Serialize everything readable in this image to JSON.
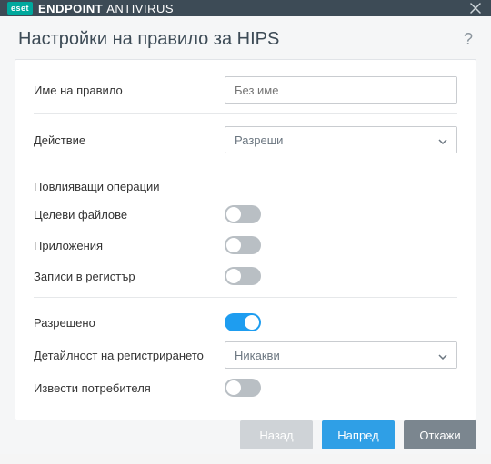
{
  "titlebar": {
    "brand_badge": "eset",
    "title_strong": "ENDPOINT",
    "title_light": "ANTIVIRUS"
  },
  "header": {
    "title": "Настройки на правило за HIPS",
    "help": "?"
  },
  "form": {
    "rule_name_label": "Име на правило",
    "rule_name_placeholder": "Без име",
    "rule_name_value": "",
    "action_label": "Действие",
    "action_value": "Разреши",
    "ops_title": "Повлияващи операции",
    "target_files_label": "Целеви файлове",
    "target_files_on": false,
    "apps_label": "Приложения",
    "apps_on": false,
    "registry_label": "Записи в регистър",
    "registry_on": false,
    "enabled_label": "Разрешено",
    "enabled_on": true,
    "log_detail_label": "Детайлност на регистрирането",
    "log_detail_value": "Никакви",
    "notify_label": "Извести потребителя",
    "notify_on": false
  },
  "footer": {
    "back": "Назад",
    "next": "Напред",
    "cancel": "Откажи"
  }
}
